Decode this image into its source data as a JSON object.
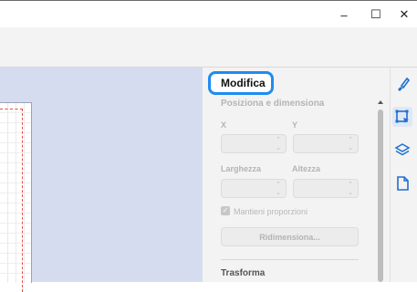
{
  "window": {
    "minimize_glyph": "–",
    "maximize_glyph": "☐",
    "close_glyph": "✕"
  },
  "panel": {
    "title": "Modifica",
    "section_position": "Posiziona e dimensiona",
    "x_label": "X",
    "y_label": "Y",
    "x_value": "",
    "y_value": "",
    "width_label": "Larghezza",
    "height_label": "Altezza",
    "width_value": "",
    "height_value": "",
    "keep_proportions_label": "Mantieni proporzioni",
    "keep_proportions_checked": true,
    "resize_button": "Ridimensiona...",
    "section_transform": "Trasforma"
  },
  "rail": {
    "icons": [
      "paint-brush-icon",
      "edit-selection-icon",
      "layers-icon",
      "page-icon"
    ],
    "active": "edit-selection-icon"
  },
  "colors": {
    "canvas_bg": "#d6dcef",
    "panel_bg": "#f3f3f3",
    "highlight": "#1e8cf0",
    "icon_blue": "#1f6fd0"
  }
}
